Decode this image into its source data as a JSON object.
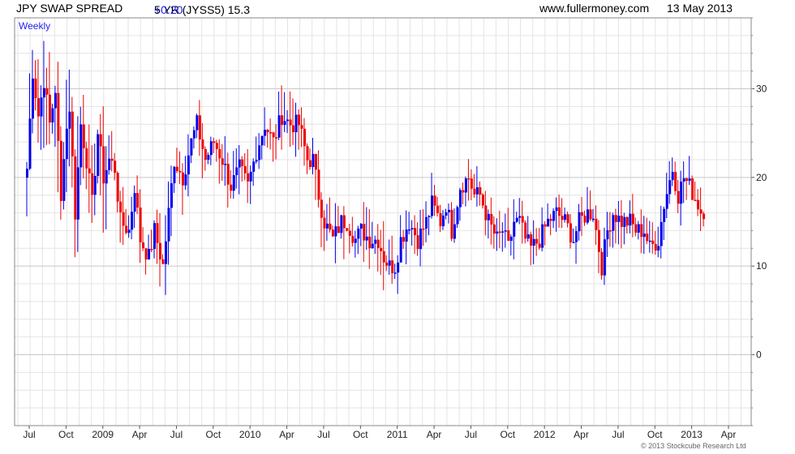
{
  "header": {
    "title": "JPY SWAP SPREAD",
    "symbol": "5 YR (JYSS5) 15.3",
    "change": "+0.20",
    "site": "www.fullermoney.com",
    "date": "13 May 2013"
  },
  "footer": {
    "copyright": "© 2013 Stockcube Research Ltd"
  },
  "chart_data": {
    "type": "bar",
    "subtype": "ohlc-weekly",
    "label": "Weekly",
    "ylim": [
      -8,
      38
    ],
    "yticks": [
      0,
      10,
      20,
      30
    ],
    "grid": true,
    "up_color": "#0000ee",
    "down_color": "#ee0000",
    "xtick_labels": [
      "Jul",
      "Oct",
      "2009",
      "Apr",
      "Jul",
      "Oct",
      "2010",
      "Apr",
      "Jul",
      "Oct",
      "2011",
      "Apr",
      "Jul",
      "Oct",
      "2012",
      "Apr",
      "Jul",
      "Oct",
      "2013",
      "Apr"
    ],
    "xtick_week_index": [
      0,
      13,
      26,
      39,
      52,
      65,
      78,
      91,
      104,
      117,
      130,
      143,
      156,
      169,
      182,
      195,
      208,
      221,
      234,
      247
    ],
    "close_anchors": [
      [
        0,
        21
      ],
      [
        2,
        32
      ],
      [
        4,
        27
      ],
      [
        6,
        31
      ],
      [
        8,
        26
      ],
      [
        10,
        30
      ],
      [
        12,
        17
      ],
      [
        13,
        23
      ],
      [
        15,
        28
      ],
      [
        17,
        16
      ],
      [
        19,
        26
      ],
      [
        21,
        22
      ],
      [
        23,
        17
      ],
      [
        25,
        25
      ],
      [
        27,
        20
      ],
      [
        29,
        22
      ],
      [
        31,
        21
      ],
      [
        33,
        15
      ],
      [
        36,
        14
      ],
      [
        38,
        19
      ],
      [
        40,
        13
      ],
      [
        43,
        11
      ],
      [
        45,
        14
      ],
      [
        48,
        10
      ],
      [
        50,
        16
      ],
      [
        52,
        22
      ],
      [
        55,
        20
      ],
      [
        58,
        24
      ],
      [
        60,
        26
      ],
      [
        63,
        22
      ],
      [
        66,
        24
      ],
      [
        69,
        22
      ],
      [
        72,
        19
      ],
      [
        75,
        21
      ],
      [
        78,
        19
      ],
      [
        81,
        23
      ],
      [
        84,
        26
      ],
      [
        87,
        24
      ],
      [
        90,
        27
      ],
      [
        93,
        26
      ],
      [
        96,
        26
      ],
      [
        99,
        22
      ],
      [
        101,
        22
      ],
      [
        103,
        18
      ],
      [
        105,
        15
      ],
      [
        108,
        13
      ],
      [
        111,
        15
      ],
      [
        113,
        15
      ],
      [
        116,
        13
      ],
      [
        118,
        14
      ],
      [
        121,
        13
      ],
      [
        124,
        13
      ],
      [
        126,
        11
      ],
      [
        128,
        10
      ],
      [
        130,
        10
      ],
      [
        132,
        13
      ],
      [
        135,
        15
      ],
      [
        138,
        13
      ],
      [
        141,
        15
      ],
      [
        143,
        17
      ],
      [
        146,
        15
      ],
      [
        148,
        17
      ],
      [
        150,
        14
      ],
      [
        153,
        19
      ],
      [
        156,
        20
      ],
      [
        158,
        18
      ],
      [
        160,
        18
      ],
      [
        163,
        15
      ],
      [
        166,
        13
      ],
      [
        168,
        14
      ],
      [
        170,
        12
      ],
      [
        172,
        15
      ],
      [
        174,
        15
      ],
      [
        176,
        13
      ],
      [
        178,
        12
      ],
      [
        181,
        13
      ],
      [
        184,
        15
      ],
      [
        187,
        16
      ],
      [
        190,
        15
      ],
      [
        193,
        13
      ],
      [
        195,
        15
      ],
      [
        198,
        16
      ],
      [
        200,
        16
      ],
      [
        203,
        10
      ],
      [
        205,
        14
      ],
      [
        207,
        16
      ],
      [
        210,
        15
      ],
      [
        213,
        15
      ],
      [
        215,
        14
      ],
      [
        218,
        14
      ],
      [
        220,
        12
      ],
      [
        223,
        13
      ],
      [
        225,
        17
      ],
      [
        228,
        21
      ],
      [
        230,
        18
      ],
      [
        232,
        20
      ],
      [
        234,
        19
      ],
      [
        237,
        17
      ],
      [
        239,
        15.3
      ]
    ]
  }
}
